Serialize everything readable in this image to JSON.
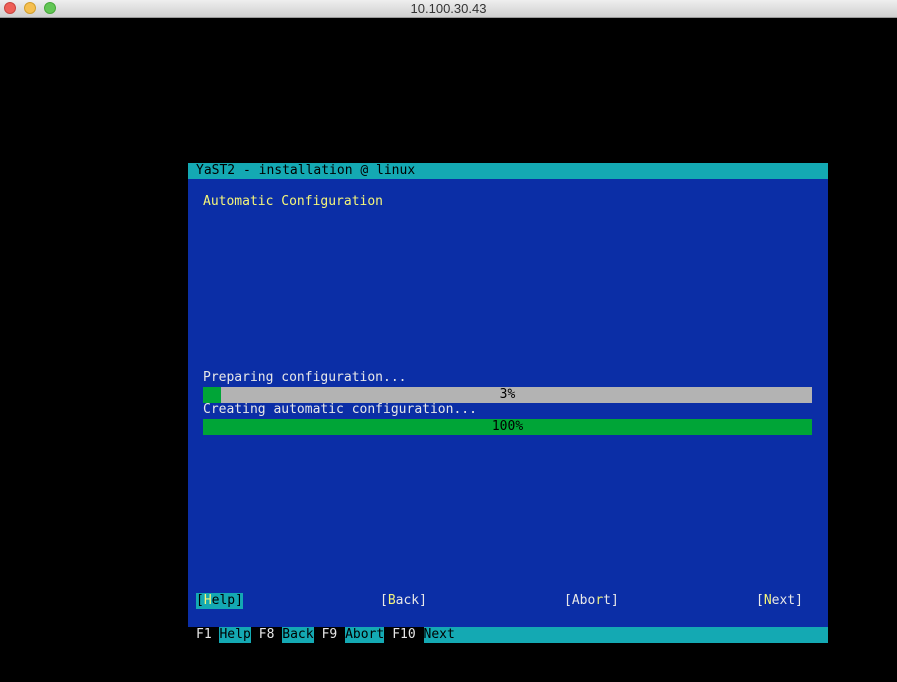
{
  "window": {
    "title": "10.100.30.43"
  },
  "yast": {
    "header": "YaST2 - installation @ linux",
    "dialog_title": "Automatic Configuration",
    "progress": [
      {
        "label": "Preparing configuration...",
        "percent_text": "3%",
        "percent": 3
      },
      {
        "label": "Creating automatic configuration...",
        "percent_text": "100%",
        "percent": 100
      }
    ],
    "buttons": {
      "help": {
        "open": "[",
        "hot": "H",
        "rest": "elp]"
      },
      "back": {
        "open": "[",
        "hot": "B",
        "rest": "ack]"
      },
      "abort": {
        "open": "[Abo",
        "hot": "r",
        "rest": "t]"
      },
      "next": {
        "open": "[",
        "hot": "N",
        "rest": "ext]"
      }
    },
    "fkeys": [
      {
        "key": "F1 ",
        "label": "Help"
      },
      {
        "key": "F8 ",
        "label": "Back"
      },
      {
        "key": "F9 ",
        "label": "Abort"
      },
      {
        "key": "F10 ",
        "label": "Next"
      }
    ]
  },
  "colors": {
    "background": "#0b2ea6",
    "accent": "#14a9b3",
    "progress_fill": "#00a537",
    "progress_track": "#b3b3b3",
    "highlight_text": "#f5f57a"
  }
}
